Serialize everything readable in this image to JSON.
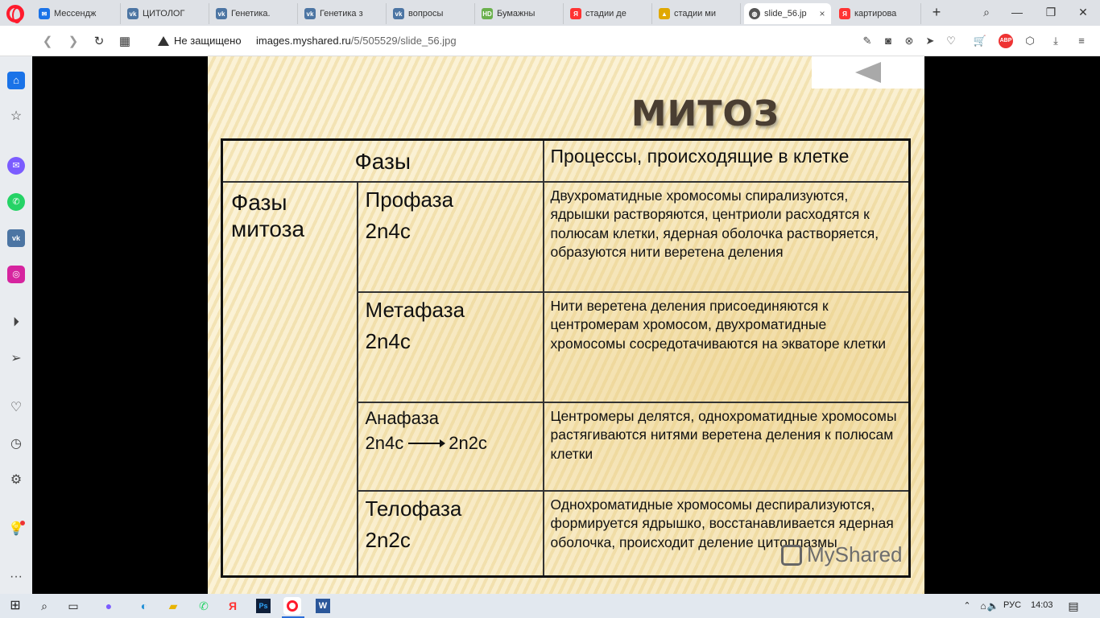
{
  "browser": {
    "tabs": [
      {
        "label": "Мессендж",
        "icon": "messenger-icon",
        "color": "#1a73e8"
      },
      {
        "label": "ЦИТОЛОГ",
        "icon": "vk-icon",
        "color": "#4c75a3"
      },
      {
        "label": "Генетика.",
        "icon": "vk-icon",
        "color": "#4c75a3"
      },
      {
        "label": "Генетика з",
        "icon": "vk-icon",
        "color": "#4c75a3"
      },
      {
        "label": "вопросы",
        "icon": "vk-icon",
        "color": "#4c75a3"
      },
      {
        "label": "Бумажны",
        "icon": "hd-icon",
        "color": "#6ab04c"
      },
      {
        "label": "стадии де",
        "icon": "yandex-icon",
        "color": "#f33"
      },
      {
        "label": "стадии ми",
        "icon": "image-icon",
        "color": "#e0a800"
      },
      {
        "label": "slide_56.jp",
        "icon": "globe-icon",
        "color": "#555"
      },
      {
        "label": "картирова",
        "icon": "yandex-icon",
        "color": "#f33"
      }
    ],
    "active_tab_index": 8,
    "tab_close_glyph": "×",
    "new_tab_glyph": "+",
    "security_label": "Не защищено",
    "url_host": "images.myshared.ru",
    "url_path": "/5/505529/slide_56.jpg"
  },
  "slide": {
    "title": "МИТОЗ",
    "headers": {
      "phases": "Фазы",
      "processes": "Процессы, происходящие в клетке"
    },
    "group_label": "Фазы митоза",
    "rows": [
      {
        "phase": "Профаза",
        "formula": "2n4c",
        "description": "Двухроматидные хромосомы спирализуются, ядрышки растворяются, центриоли расходятся к полюсам клетки, ядерная оболочка растворяется, образуются нити веретена деления"
      },
      {
        "phase": "Метафаза",
        "formula": "2n4c",
        "description": "Нити веретена деления присоединяются к центромерам хромосом, двухроматидные хромосомы сосредотачиваются на экваторе клетки"
      },
      {
        "phase": "Анафаза",
        "formula_from": "2n4c",
        "formula_to": "2n2c",
        "description": "Центромеры делятся, однохроматидные хромосомы растягиваются нитями веретена деления к полюсам клетки"
      },
      {
        "phase": "Телофаза",
        "formula": "2n2c",
        "description": "Однохроматидные хромосомы деспирализуются, формируется ядрышко, восстанавливается ядерная оболочка, происходит деление цитоплазмы"
      }
    ],
    "watermark": "MyShared"
  },
  "taskbar": {
    "language": "РУС",
    "time": "14:03"
  }
}
